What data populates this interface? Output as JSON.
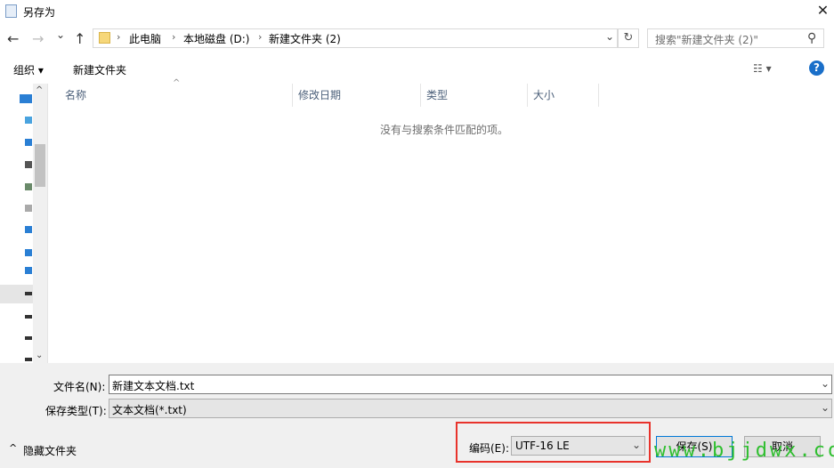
{
  "window": {
    "title": "另存为",
    "close": "✕"
  },
  "nav": {
    "back": "←",
    "forward": "→",
    "recent": "⌄",
    "up": "↑",
    "breadcrumb": [
      "此电脑",
      "本地磁盘 (D:)",
      "新建文件夹 (2)"
    ],
    "sep": "›",
    "dropdown": "⌄",
    "refresh": "↻",
    "search_placeholder": "搜索\"新建文件夹 (2)\"",
    "search_icon": "⚲"
  },
  "toolbar": {
    "organize": "组织 ▾",
    "new_folder": "新建文件夹",
    "view": "☷ ▾",
    "help": "?"
  },
  "list": {
    "columns": [
      "名称",
      "修改日期",
      "类型",
      "大小"
    ],
    "sort_arrow": "^",
    "empty_message": "没有与搜索条件匹配的项。"
  },
  "form": {
    "filename_label": "文件名(N):",
    "filename_value": "新建文本文档.txt",
    "filetype_label": "保存类型(T):",
    "filetype_value": "文本文档(*.txt)",
    "hide_folders": "隐藏文件夹",
    "hide_arrow": "^",
    "encoding_label": "编码(E):",
    "encoding_value": "UTF-16 LE",
    "save": "保存(S)",
    "cancel": "取消"
  },
  "watermark": "www.bjjdwx.com"
}
